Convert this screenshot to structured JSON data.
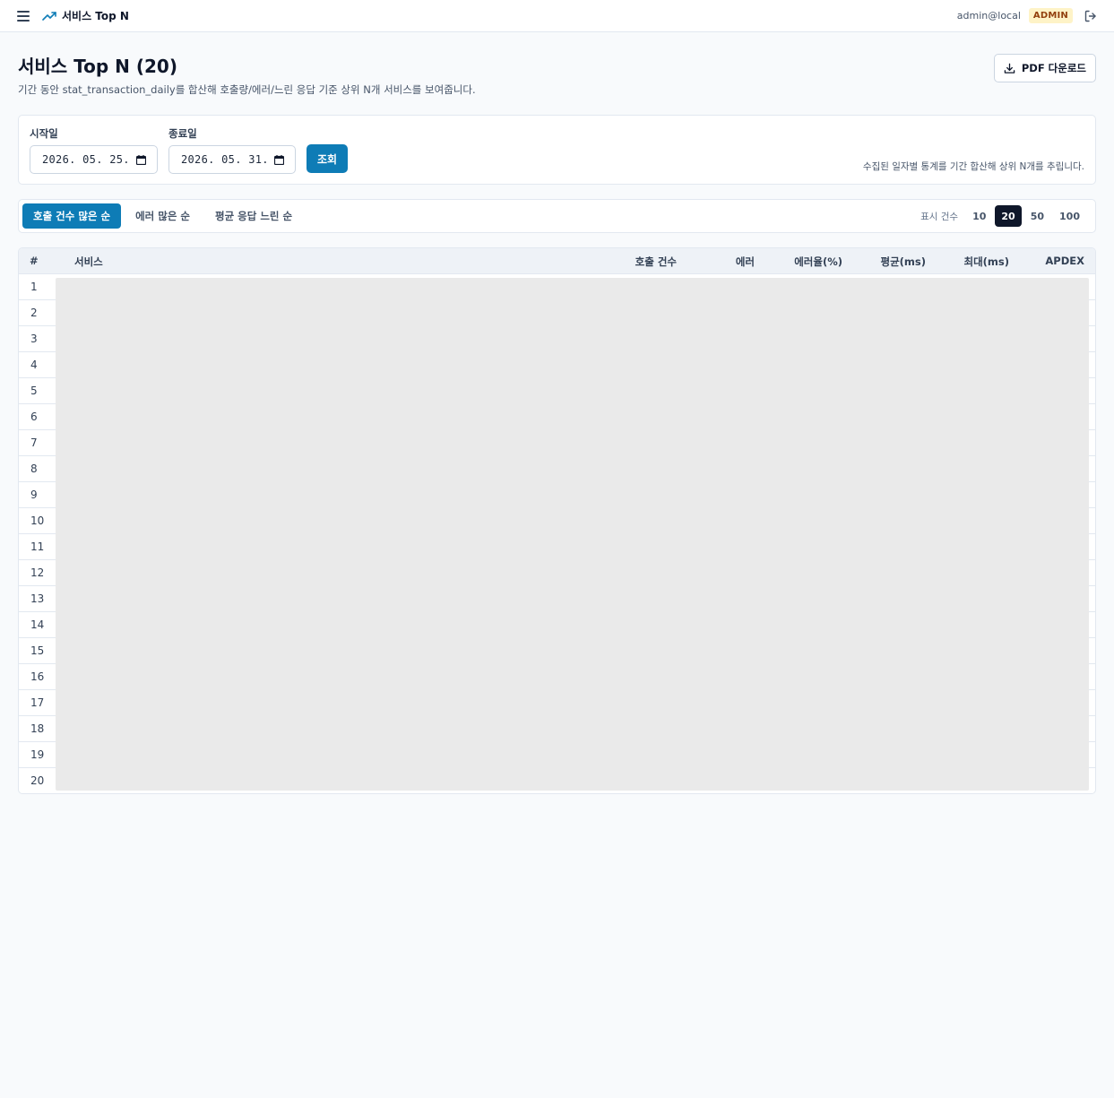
{
  "header": {
    "title": "서비스 Top N",
    "user_email": "admin@local",
    "role": "ADMIN"
  },
  "page": {
    "title": "서비스 Top N (20)",
    "description": "기간 동안 stat_transaction_daily를 합산해 호출량/에러/느린 응답 기준 상위 N개 서비스를 보여줍니다.",
    "pdf_button": "PDF 다운로드"
  },
  "filters": {
    "start_label": "시작일",
    "start_value": "2026. 05. 25.",
    "end_label": "종료일",
    "end_value": "2026. 05. 31.",
    "query_button": "조회",
    "note": "수집된 일자별 통계를 기간 합산해 상위 N개를 추립니다."
  },
  "sort": {
    "tabs": [
      "호출 건수 많은 순",
      "에러 많은 순",
      "평균 응답 느린 순"
    ],
    "active_index": 0,
    "count_label": "표시 건수",
    "count_options": [
      "10",
      "20",
      "50",
      "100"
    ],
    "count_active": "20"
  },
  "table": {
    "columns": [
      "#",
      "서비스",
      "호출 건수",
      "에러",
      "에러율(%)",
      "평균(ms)",
      "최대(ms)",
      "APDEX"
    ],
    "row_numbers": [
      "1",
      "2",
      "3",
      "4",
      "5",
      "6",
      "7",
      "8",
      "9",
      "10",
      "11",
      "12",
      "13",
      "14",
      "15",
      "16",
      "17",
      "18",
      "19",
      "20"
    ]
  },
  "colors": {
    "accent": "#0e7cb6",
    "badge_bg": "#fef3c7",
    "badge_text": "#92400e",
    "skeleton": "#eaeaea"
  }
}
